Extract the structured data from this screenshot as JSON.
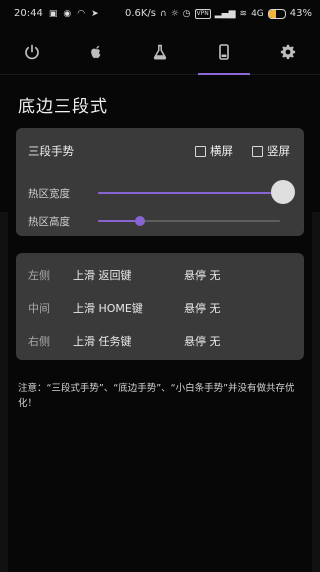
{
  "status_bar": {
    "time": "20:44",
    "network_speed": "0.6K/s",
    "vpn": "VPN",
    "network_type": "4G",
    "battery_percent": "43%",
    "battery_level": 0.43,
    "icons": [
      "sim-notification-icon",
      "wechat-icon",
      "gauge-icon",
      "location-icon",
      "headphones-icon",
      "brightness-icon",
      "alarm-icon",
      "vpn-icon",
      "signal-icon",
      "wifi-icon",
      "signal-4g-icon",
      "battery-icon"
    ]
  },
  "tabs": [
    {
      "icon": "power-icon",
      "active": false
    },
    {
      "icon": "apple-icon",
      "active": false
    },
    {
      "icon": "flask-icon",
      "active": false
    },
    {
      "icon": "phone-icon",
      "active": true
    },
    {
      "icon": "gear-icon",
      "active": false
    }
  ],
  "page": {
    "title": "底边三段式"
  },
  "gesture_card": {
    "title": "三段手势",
    "landscape_label": "横屏",
    "portrait_label": "竖屏",
    "landscape_checked": false,
    "portrait_checked": false,
    "width_label": "热区宽度",
    "height_label": "热区高度",
    "width_value": 0.98,
    "height_value": 0.23
  },
  "action_card": {
    "rows": [
      {
        "side": "左侧",
        "slide_prefix": "上滑 ",
        "slide_action": "返回键",
        "hold_prefix": "悬停 ",
        "hold_action": "无"
      },
      {
        "side": "中间",
        "slide_prefix": "上滑 ",
        "slide_action": "HOME键",
        "hold_prefix": "悬停 ",
        "hold_action": "无"
      },
      {
        "side": "右侧",
        "slide_prefix": "上滑 ",
        "slide_action": "任务键",
        "hold_prefix": "悬停 ",
        "hold_action": "无"
      }
    ]
  },
  "note": "注意：“三段式手势”、“底边手势”、“小白条手势”并没有做共存优化！",
  "colors": {
    "background": "#070707",
    "card": "#3a3a3a",
    "accent": "#8865d2",
    "tab_indicator": "#8d67d7"
  }
}
